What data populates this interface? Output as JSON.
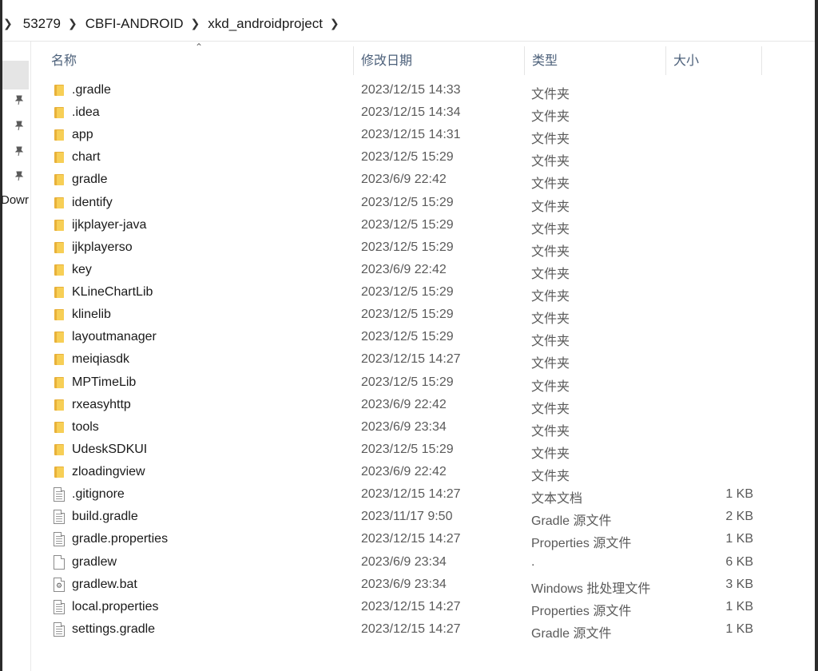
{
  "breadcrumb": {
    "items": [
      "53279",
      "CBFI-ANDROID",
      "xkd_androidproject"
    ]
  },
  "nav": {
    "partial_label": "Dowr"
  },
  "columns": {
    "name": "名称",
    "date": "修改日期",
    "type": "类型",
    "size": "大小"
  },
  "files": [
    {
      "name": ".gradle",
      "date": "2023/12/15 14:33",
      "type": "文件夹",
      "size": "",
      "icon": "folder-icon"
    },
    {
      "name": ".idea",
      "date": "2023/12/15 14:34",
      "type": "文件夹",
      "size": "",
      "icon": "folder-icon"
    },
    {
      "name": "app",
      "date": "2023/12/15 14:31",
      "type": "文件夹",
      "size": "",
      "icon": "folder-icon"
    },
    {
      "name": "chart",
      "date": "2023/12/5 15:29",
      "type": "文件夹",
      "size": "",
      "icon": "folder-icon"
    },
    {
      "name": "gradle",
      "date": "2023/6/9 22:42",
      "type": "文件夹",
      "size": "",
      "icon": "folder-icon"
    },
    {
      "name": "identify",
      "date": "2023/12/5 15:29",
      "type": "文件夹",
      "size": "",
      "icon": "folder-icon"
    },
    {
      "name": "ijkplayer-java",
      "date": "2023/12/5 15:29",
      "type": "文件夹",
      "size": "",
      "icon": "folder-icon"
    },
    {
      "name": "ijkplayerso",
      "date": "2023/12/5 15:29",
      "type": "文件夹",
      "size": "",
      "icon": "folder-icon"
    },
    {
      "name": "key",
      "date": "2023/6/9 22:42",
      "type": "文件夹",
      "size": "",
      "icon": "folder-icon"
    },
    {
      "name": "KLineChartLib",
      "date": "2023/12/5 15:29",
      "type": "文件夹",
      "size": "",
      "icon": "folder-icon"
    },
    {
      "name": "klinelib",
      "date": "2023/12/5 15:29",
      "type": "文件夹",
      "size": "",
      "icon": "folder-icon"
    },
    {
      "name": "layoutmanager",
      "date": "2023/12/5 15:29",
      "type": "文件夹",
      "size": "",
      "icon": "folder-icon"
    },
    {
      "name": "meiqiasdk",
      "date": "2023/12/15 14:27",
      "type": "文件夹",
      "size": "",
      "icon": "folder-icon"
    },
    {
      "name": "MPTimeLib",
      "date": "2023/12/5 15:29",
      "type": "文件夹",
      "size": "",
      "icon": "folder-icon"
    },
    {
      "name": "rxeasyhttp",
      "date": "2023/6/9 22:42",
      "type": "文件夹",
      "size": "",
      "icon": "folder-icon"
    },
    {
      "name": "tools",
      "date": "2023/6/9 23:34",
      "type": "文件夹",
      "size": "",
      "icon": "folder-icon"
    },
    {
      "name": "UdeskSDKUI",
      "date": "2023/12/5 15:29",
      "type": "文件夹",
      "size": "",
      "icon": "folder-icon"
    },
    {
      "name": "zloadingview",
      "date": "2023/6/9 22:42",
      "type": "文件夹",
      "size": "",
      "icon": "folder-icon"
    },
    {
      "name": ".gitignore",
      "date": "2023/12/15 14:27",
      "type": "文本文档",
      "size": "1 KB",
      "icon": "text-file-icon"
    },
    {
      "name": "build.gradle",
      "date": "2023/11/17 9:50",
      "type": "Gradle 源文件",
      "size": "2 KB",
      "icon": "text-file-icon"
    },
    {
      "name": "gradle.properties",
      "date": "2023/12/15 14:27",
      "type": "Properties 源文件",
      "size": "1 KB",
      "icon": "text-file-icon"
    },
    {
      "name": "gradlew",
      "date": "2023/6/9 23:34",
      "type": ".",
      "size": "6 KB",
      "icon": "blank-file-icon"
    },
    {
      "name": "gradlew.bat",
      "date": "2023/6/9 23:34",
      "type": "Windows 批处理文件",
      "size": "3 KB",
      "icon": "batch-file-icon"
    },
    {
      "name": "local.properties",
      "date": "2023/12/15 14:27",
      "type": "Properties 源文件",
      "size": "1 KB",
      "icon": "text-file-icon"
    },
    {
      "name": "settings.gradle",
      "date": "2023/12/15 14:27",
      "type": "Gradle 源文件",
      "size": "1 KB",
      "icon": "text-file-icon"
    }
  ]
}
